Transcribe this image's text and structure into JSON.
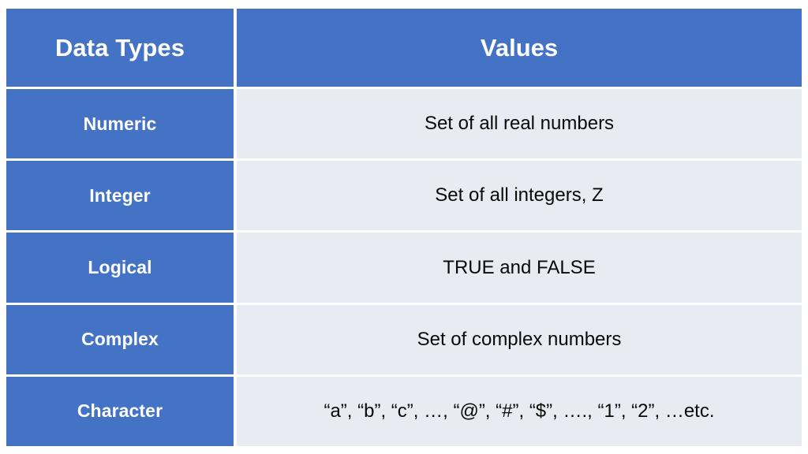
{
  "table": {
    "columns": [
      {
        "key": "data_types",
        "label": "Data Types"
      },
      {
        "key": "values",
        "label": "Values"
      }
    ],
    "rows": [
      {
        "type": "Numeric",
        "value": "Set of all real numbers"
      },
      {
        "type": "Integer",
        "value": "Set of all integers, Z"
      },
      {
        "type": "Logical",
        "value": "TRUE and FALSE"
      },
      {
        "type": "Complex",
        "value": "Set of complex numbers"
      },
      {
        "type": "Character",
        "value": "“a”, “b”, “c”, …, “@”, “#”, “$”, …., “1”, “2”, …etc."
      }
    ]
  },
  "colors": {
    "header_blue": "#4472C4",
    "type_cell_blue": "#4472C4",
    "value_cell_background": "#E8EBF2",
    "page_background": "#FFFFFF",
    "header_text": "#FFFFFF",
    "value_text": "#0A0A0A"
  }
}
